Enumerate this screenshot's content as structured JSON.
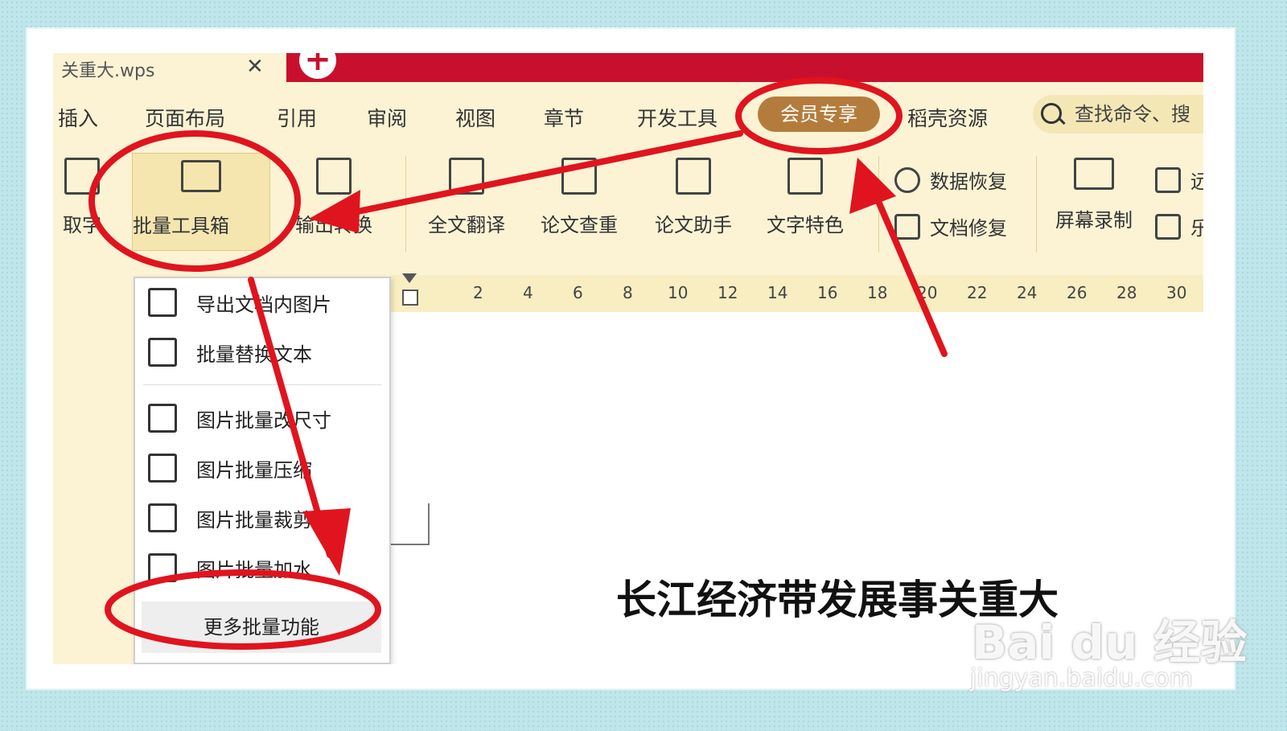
{
  "tab": {
    "title": "关重大.wps",
    "close": "✕",
    "add": "+"
  },
  "menu": {
    "items": [
      "插入",
      "页面布局",
      "引用",
      "审阅",
      "视图",
      "章节",
      "开发工具"
    ],
    "vip": "会员专享",
    "resources": "稻壳资源",
    "search_placeholder": "查找命令、搜"
  },
  "ribbon": {
    "extract_text": "取字",
    "batch_toolbox": "批量工具箱",
    "output_convert": "输出转换",
    "translate": "全文翻译",
    "check": "论文查重",
    "assistant": "论文助手",
    "text_effects": "文字特色",
    "data_recovery": "数据恢复",
    "doc_repair": "文档修复",
    "screen_record": "屏幕录制",
    "partial_top": "远",
    "partial_bottom": "乐"
  },
  "ruler": {
    "ticks": [
      "2",
      "4",
      "6",
      "8",
      "10",
      "12",
      "14",
      "16",
      "18",
      "20",
      "22",
      "24",
      "26",
      "28",
      "30"
    ]
  },
  "dropdown": {
    "items": [
      "导出文档内图片",
      "批量替换文本",
      "图片批量改尺寸",
      "图片批量压缩",
      "图片批量裁剪",
      "图片批量加水"
    ],
    "more": "更多批量功能"
  },
  "document": {
    "title": "长江经济带发展事关重大"
  },
  "watermark": {
    "logo": "Bai du 经验",
    "url": "jingyan.baidu.com"
  },
  "colors": {
    "tabbar": "#c8102e",
    "ribbon_bg": "#fbf3d4",
    "vip": "#b47c3c",
    "annotation": "#e0141e"
  }
}
